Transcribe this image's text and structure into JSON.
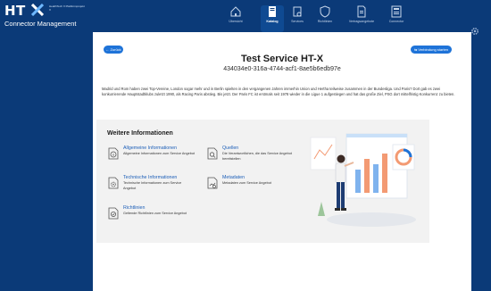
{
  "brand": {
    "logo_text": "HT",
    "logo_sub": "HealthTech X Plattformprojekt X",
    "app_title": "Connector Management"
  },
  "nav": {
    "items": [
      {
        "label": "Übersicht",
        "icon": "home-icon",
        "active": false
      },
      {
        "label": "Katalog",
        "icon": "catalog-icon",
        "active": true
      },
      {
        "label": "Services",
        "icon": "services-icon",
        "active": false
      },
      {
        "label": "Richtlinien",
        "icon": "shield-icon",
        "active": false
      },
      {
        "label": "Vertragsangebote",
        "icon": "document-icon",
        "active": false
      },
      {
        "label": "Connector",
        "icon": "connector-icon",
        "active": false
      }
    ],
    "settings_icon": "gear-icon"
  },
  "actions": {
    "back_label": "← Zurück",
    "connect_label": "⇆ Verbindung starten"
  },
  "service": {
    "title": "Test Service HT-X",
    "id": "434034e0-316a-4744-acf1-8ae5b6edb97e",
    "description": "Madrid und Rom haben zwei Top-Vereine, London sogar mehr und in Berlin spielten in den vergangenen Jahren immerhin Union und Hertha teilweise zusammen in der Bundesliga. Und Paris? Dort gab es zwei konkurrierende Hauptstadtklubs zuletzt 1990, als Racing Paris abstieg. Bis jetzt. Der Paris FC ist erstmals seit 1978 wieder in die Ligue 1 aufgestiegen und hat das große Ziel, PSG dort mittelfristig Konkurrenz zu bieten."
  },
  "info": {
    "heading": "Weitere Informationen",
    "cards": [
      {
        "title": "Allgemeine Informationen",
        "desc": "Allgemeine Informationen zum Service Angebot",
        "icon": "info-icon"
      },
      {
        "title": "Quellen",
        "desc": "Die Verantwortlichen, die das Service Angebot bereitstellen",
        "icon": "search-document-icon"
      },
      {
        "title": "Technische Informationen",
        "desc": "Technische Informationen zum Service Angebot",
        "icon": "gear-document-icon"
      },
      {
        "title": "Metadaten",
        "desc": "Metadaten zum Service Angebot",
        "icon": "metadata-icon"
      },
      {
        "title": "Richtlinien",
        "desc": "Geltende Richtlinien zum Service Angebot",
        "icon": "policy-icon"
      }
    ]
  },
  "colors": {
    "background": "#0b3a78",
    "accent": "#1e73d8",
    "link": "#1d5fb8",
    "info_box": "#f2f2f2"
  }
}
